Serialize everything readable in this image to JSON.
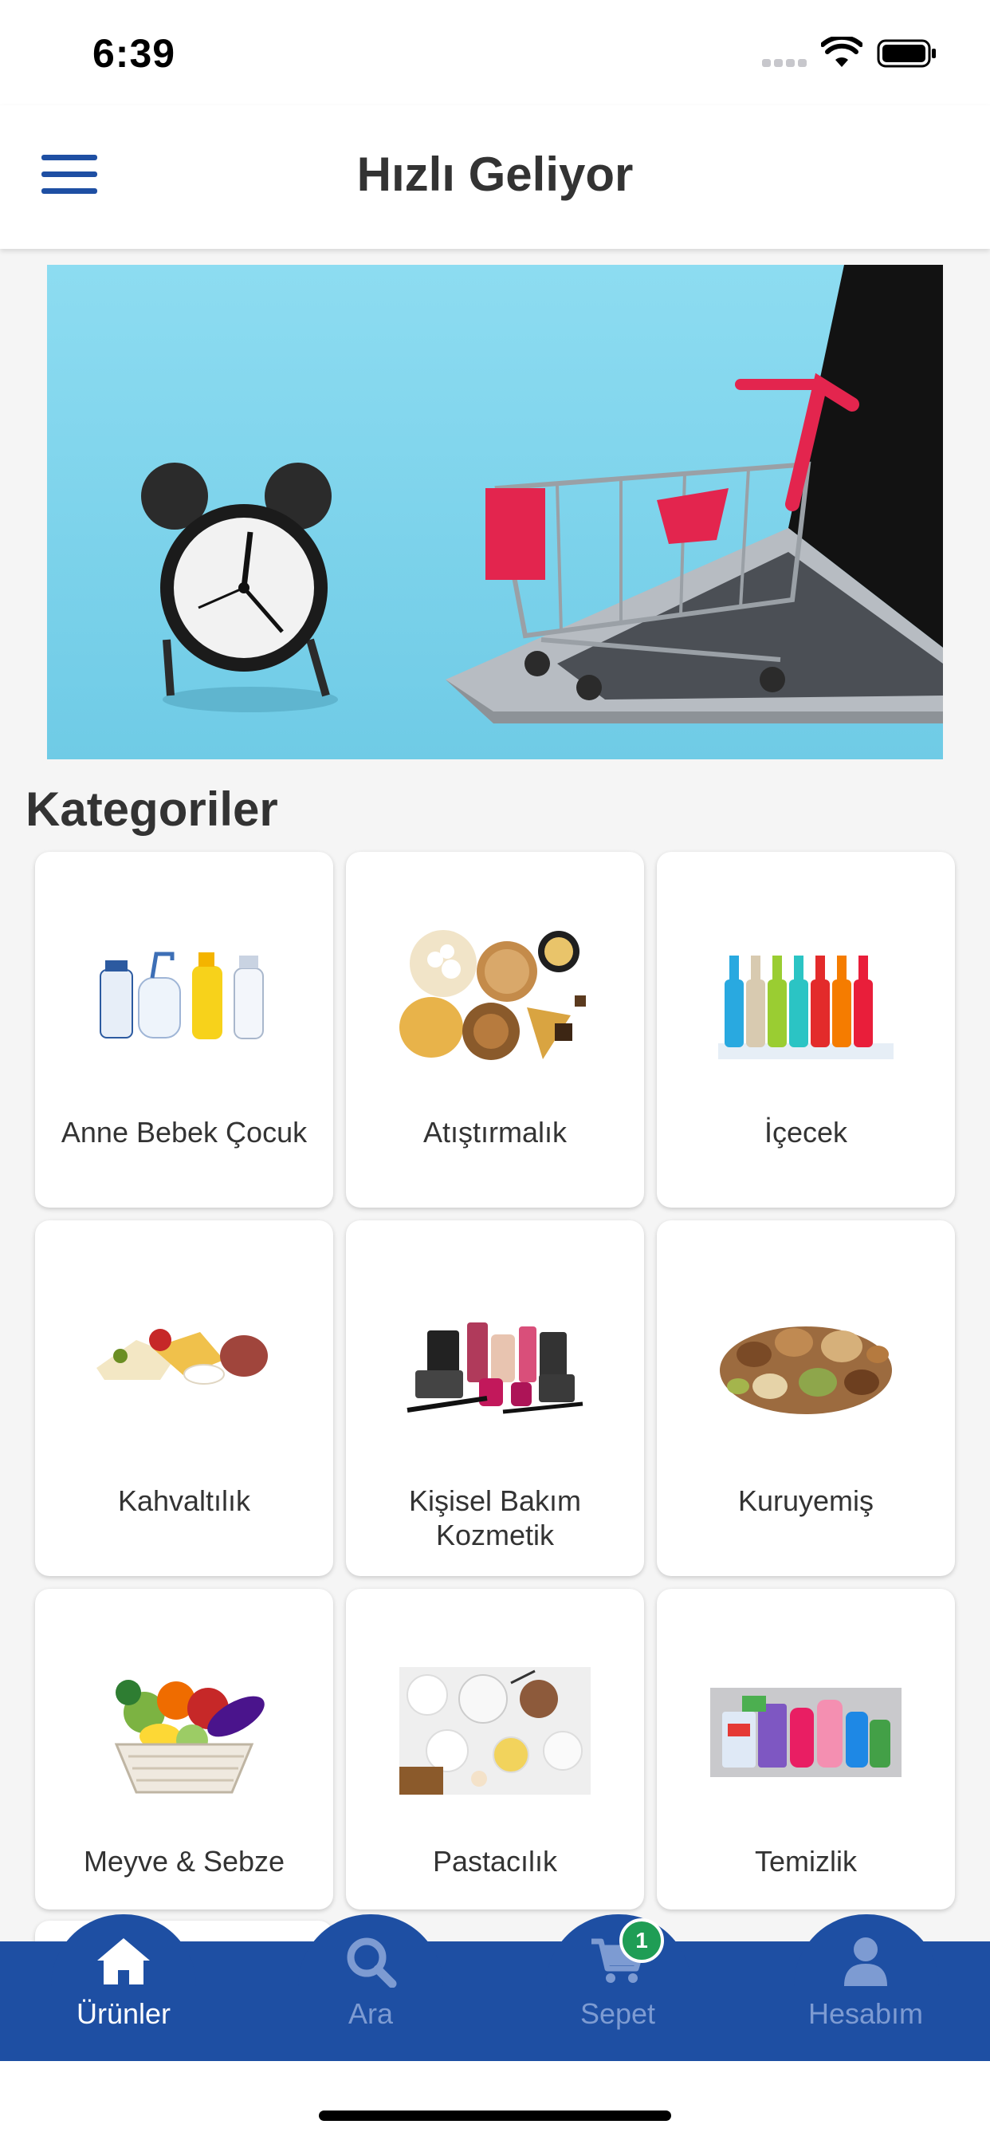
{
  "status_bar": {
    "time": "6:39"
  },
  "header": {
    "title": "Hızlı Geliyor"
  },
  "main": {
    "section_title": "Kategoriler",
    "categories": [
      {
        "label": "Anne Bebek Çocuk",
        "icon": "baby-care-products"
      },
      {
        "label": "Atıştırmalık",
        "icon": "snacks"
      },
      {
        "label": "İçecek",
        "icon": "drink-bottles"
      },
      {
        "label": "Kahvaltılık",
        "icon": "breakfast-cheese"
      },
      {
        "label": "Kişisel Bakım Kozmetik",
        "icon": "cosmetics"
      },
      {
        "label": "Kuruyemiş",
        "icon": "nuts"
      },
      {
        "label": "Meyve & Sebze",
        "icon": "fruit-basket"
      },
      {
        "label": "Pastacılık",
        "icon": "baking-supplies"
      },
      {
        "label": "Temizlik",
        "icon": "cleaning-products"
      }
    ]
  },
  "tab_bar": {
    "tabs": [
      {
        "label": "Ürünler",
        "icon": "home-icon",
        "active": true
      },
      {
        "label": "Ara",
        "icon": "search-icon",
        "active": false
      },
      {
        "label": "Sepet",
        "icon": "cart-icon",
        "active": false
      },
      {
        "label": "Hesabım",
        "icon": "user-icon",
        "active": false
      }
    ],
    "cart_badge": "1"
  },
  "colors": {
    "primary": "#1e4fa3",
    "badge": "#1f9d55",
    "banner_bg": "#7dd3ec"
  }
}
